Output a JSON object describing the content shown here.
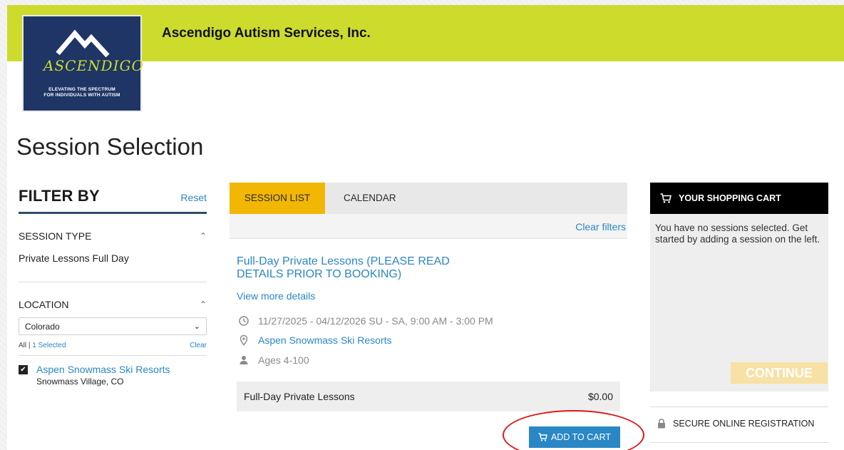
{
  "org": {
    "name": "Ascendigo Autism Services, Inc."
  },
  "logo": {
    "word": "ASCENDIGO",
    "tagline_1": "ELEVATING THE SPECTRUM",
    "tagline_2": "FOR INDIVIDUALS WITH AUTISM"
  },
  "page": {
    "title": "Session Selection"
  },
  "filter": {
    "title": "FILTER BY",
    "reset_label": "Reset",
    "session_type": {
      "label": "SESSION TYPE",
      "value": "Private Lessons Full Day"
    },
    "location": {
      "label": "LOCATION",
      "selected": "Colorado",
      "all_label": "All",
      "selected_count": "1 Selected",
      "clear_label": "Clear",
      "items": [
        {
          "name": "Aspen Snowmass Ski Resorts",
          "city": "Snowmass Village, CO",
          "checked": true
        }
      ]
    }
  },
  "tabs": {
    "active": "SESSION LIST",
    "other": "CALENDAR"
  },
  "clear_filters_label": "Clear filters",
  "session": {
    "title": "Full-Day Private Lessons (PLEASE READ DETAILS PRIOR TO BOOKING)",
    "view_details_label": "View more details",
    "dates": "11/27/2025 - 04/12/2026  SU - SA, 9:00 AM - 3:00 PM",
    "location": "Aspen Snowmass Ski Resorts",
    "ages": "Ages 4-100",
    "price_name": "Full-Day Private Lessons",
    "price": "$0.00",
    "add_to_cart_label": "ADD TO CART"
  },
  "cart": {
    "title": "YOUR SHOPPING CART",
    "message": "You have no sessions selected. Get started by adding a session on the left.",
    "continue_label": "CONTINUE"
  },
  "secure_label": "SECURE ONLINE REGISTRATION",
  "colors": {
    "banner": "#cddc2c",
    "accent_link": "#2a87c6",
    "tab_active": "#f2b705",
    "logo_bg": "#1e3566",
    "annotation": "#e01616"
  }
}
